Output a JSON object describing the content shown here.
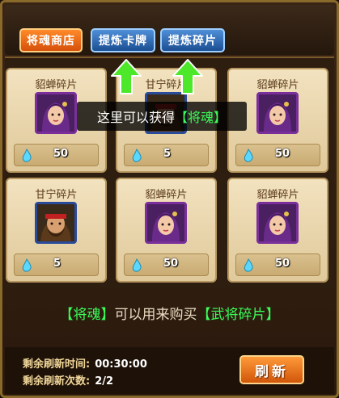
{
  "tabs": [
    {
      "label": "将魂商店",
      "active": true
    },
    {
      "label": "提炼卡牌",
      "active": false
    },
    {
      "label": "提炼碎片",
      "active": false
    }
  ],
  "shop_items": [
    {
      "name": "貂蝉碎片",
      "price": "50",
      "portrait": "diaochan-portrait"
    },
    {
      "name": "甘宁碎片",
      "price": "5",
      "portrait": "ganning-portrait"
    },
    {
      "name": "貂蝉碎片",
      "price": "50",
      "portrait": "diaochan-portrait"
    },
    {
      "name": "甘宁碎片",
      "price": "5",
      "portrait": "ganning-portrait"
    },
    {
      "name": "貂蝉碎片",
      "price": "50",
      "portrait": "diaochan-portrait"
    },
    {
      "name": "貂蝉碎片",
      "price": "50",
      "portrait": "diaochan-portrait"
    }
  ],
  "tooltip": {
    "prefix": "这里可以获得",
    "highlight": "【将魂】"
  },
  "info": {
    "part1": "【将魂】",
    "part2": "可以用来购买",
    "part3": "【武将碎片】"
  },
  "refresh": {
    "time_label": "剩余刷新时间:",
    "time_value": "00:30:00",
    "count_label": "剩余刷新次数:",
    "count_value": "2/2",
    "button_label": "刷新"
  },
  "colors": {
    "highlight_green": "#3aff5a",
    "active_tab": "#e8701a",
    "blue_tab": "#2f6fc0"
  }
}
